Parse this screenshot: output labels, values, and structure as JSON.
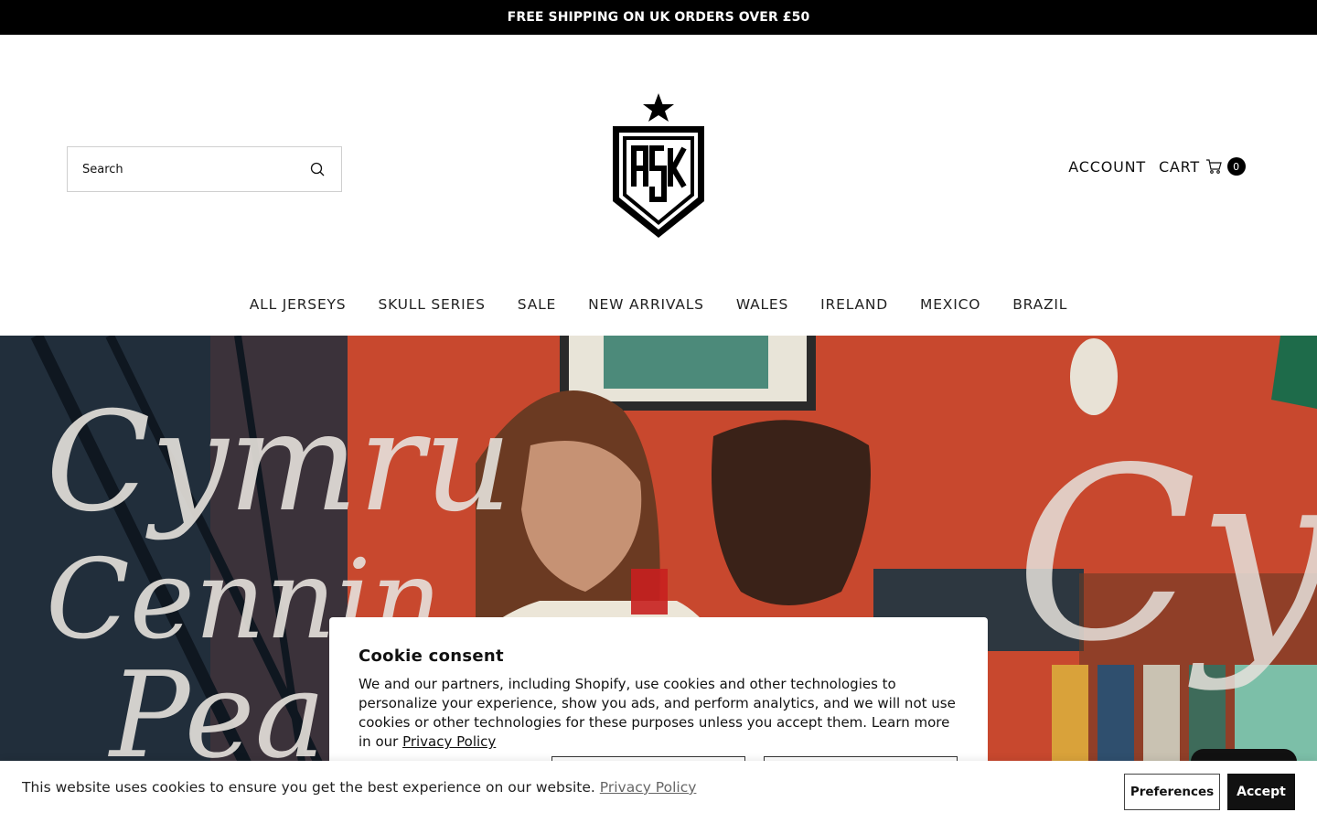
{
  "announcement": {
    "text": "FREE SHIPPING ON UK ORDERS OVER £50"
  },
  "header": {
    "search": {
      "placeholder": "Search",
      "icon": "search-icon"
    },
    "logo": {
      "letters": "ASK",
      "icon": "star-icon"
    },
    "account_label": "ACCOUNT",
    "cart_label": "CART",
    "cart_count": "0",
    "cart_icon": "cart-icon"
  },
  "nav": {
    "items": [
      {
        "label": "ALL JERSEYS"
      },
      {
        "label": "SKULL SERIES"
      },
      {
        "label": "SALE"
      },
      {
        "label": "NEW ARRIVALS"
      },
      {
        "label": "WALES"
      },
      {
        "label": "IRELAND"
      },
      {
        "label": "MEXICO"
      },
      {
        "label": "BRAZIL"
      }
    ]
  },
  "hero": {
    "script_left_1": "Cymru",
    "script_left_2": "Cennin",
    "script_left_3": "Pea",
    "script_right": "Cy"
  },
  "consent_modal": {
    "title": "Cookie consent",
    "body": "We and our partners, including Shopify, use cookies and other technologies to personalize your experience, show you ads, and perform analytics, and we will not use cookies or other technologies for these purposes unless you accept them. Learn more in our ",
    "link": "Privacy Policy"
  },
  "cookie_bar": {
    "message": "This website uses cookies to ensure you get the best experience on our website.",
    "link": "Privacy Policy",
    "preferences_label": "Preferences",
    "accept_label": "Accept"
  },
  "colors": {
    "accent": "#000000",
    "hero_bg": "#c8402a"
  }
}
